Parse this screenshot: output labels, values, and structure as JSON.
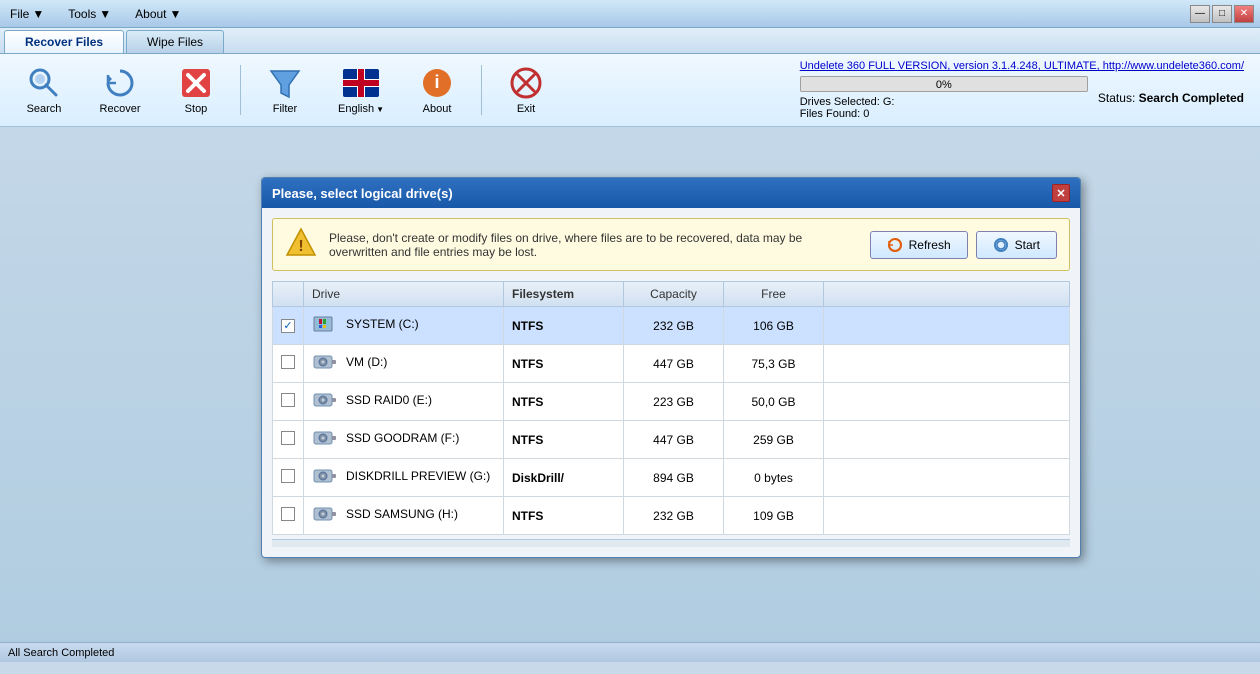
{
  "app": {
    "title": "Undelete 360",
    "version_link": "Undelete 360 FULL VERSION, version 3.1.4.248, ULTIMATE, http://www.undelete360.com/"
  },
  "menu": {
    "file": "File",
    "tools": "Tools",
    "about": "About"
  },
  "tabs": {
    "recover_files": "Recover Files",
    "wipe_files": "Wipe Files"
  },
  "toolbar": {
    "search_label": "Search",
    "recover_label": "Recover",
    "stop_label": "Stop",
    "filter_label": "Filter",
    "english_label": "English",
    "about_label": "About",
    "exit_label": "Exit"
  },
  "status": {
    "progress": "0%",
    "drives_selected": "Drives Selected: G:",
    "files_found": "Files Found: 0",
    "status_label": "Status:",
    "status_value": "Search Completed"
  },
  "dialog": {
    "title": "Please, select logical drive(s)",
    "warning_text": "Please, don't create or modify files on drive, where files are to be recovered, data may be overwritten and file entries may be lost.",
    "refresh_btn": "Refresh",
    "start_btn": "Start",
    "columns": {
      "drive": "Drive",
      "filesystem": "Filesystem",
      "capacity": "Capacity",
      "free": "Free"
    },
    "drives": [
      {
        "id": "c",
        "checked": true,
        "name": "SYSTEM (C:)",
        "filesystem": "NTFS",
        "capacity": "232 GB",
        "free": "106 GB",
        "selected": true,
        "icon_type": "windows"
      },
      {
        "id": "d",
        "checked": false,
        "name": "VM (D:)",
        "filesystem": "NTFS",
        "capacity": "447 GB",
        "free": "75,3 GB",
        "selected": false,
        "icon_type": "disk"
      },
      {
        "id": "e",
        "checked": false,
        "name": "SSD RAID0 (E:)",
        "filesystem": "NTFS",
        "capacity": "223 GB",
        "free": "50,0 GB",
        "selected": false,
        "icon_type": "disk"
      },
      {
        "id": "f",
        "checked": false,
        "name": "SSD GOODRAM (F:)",
        "filesystem": "NTFS",
        "capacity": "447 GB",
        "free": "259 GB",
        "selected": false,
        "icon_type": "disk"
      },
      {
        "id": "g",
        "checked": false,
        "name": "DISKDRILL PREVIEW (G:)",
        "filesystem": "DiskDrill/",
        "capacity": "894 GB",
        "free": "0 bytes",
        "selected": false,
        "icon_type": "disk"
      },
      {
        "id": "h",
        "checked": false,
        "name": "SSD SAMSUNG (H:)",
        "filesystem": "NTFS",
        "capacity": "232 GB",
        "free": "109 GB",
        "selected": false,
        "icon_type": "disk"
      }
    ]
  },
  "bottom_bar": {
    "text": "All Search Completed"
  },
  "win_controls": {
    "minimize": "—",
    "maximize": "□",
    "close": "✕"
  }
}
